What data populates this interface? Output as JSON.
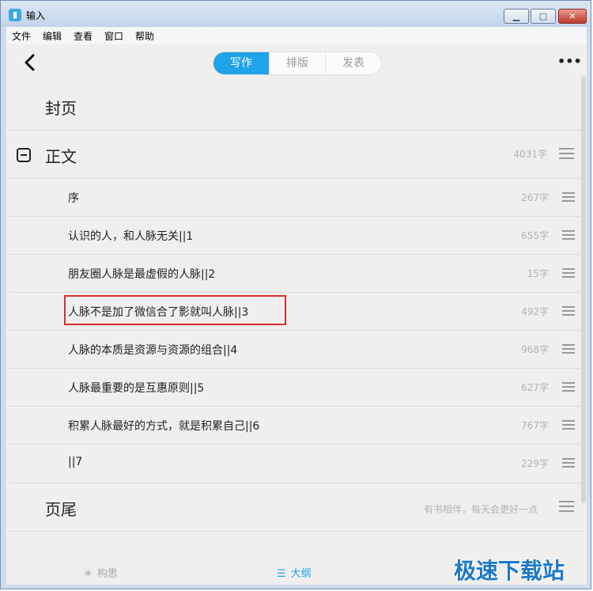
{
  "window": {
    "title": "输入"
  },
  "menubar": {
    "items": [
      "文件",
      "编辑",
      "查看",
      "窗口",
      "帮助"
    ]
  },
  "tabs": {
    "items": [
      "写作",
      "排版",
      "发表"
    ],
    "active": "写作"
  },
  "cover": {
    "label": "封页"
  },
  "body_section": {
    "label": "正文",
    "count": "4031字"
  },
  "chapters": [
    {
      "title": "序",
      "count": "267字"
    },
    {
      "title": "认识的人，和人脉无关||1",
      "count": "655字"
    },
    {
      "title": "朋友圈人脉是最虚假的人脉||2",
      "count": "15字"
    },
    {
      "title": "人脉不是加了微信合了影就叫人脉||3",
      "count": "492字"
    },
    {
      "title": "人脉的本质是资源与资源的组合||4",
      "count": "968字"
    },
    {
      "title": "人脉最重要的是互惠原则||5",
      "count": "627字"
    },
    {
      "title": "积累人脉最好的方式，就是积累自己||6",
      "count": "767字"
    },
    {
      "title": "||7",
      "count": "229字"
    }
  ],
  "footer_section": {
    "label": "页尾",
    "note": "有书相伴，每天会更好一点"
  },
  "bottombar": {
    "items": [
      "构思",
      "大纲"
    ]
  },
  "watermark": "极速下载站",
  "colors": {
    "accent": "#1fa3ea",
    "highlight": "#d6302d"
  }
}
